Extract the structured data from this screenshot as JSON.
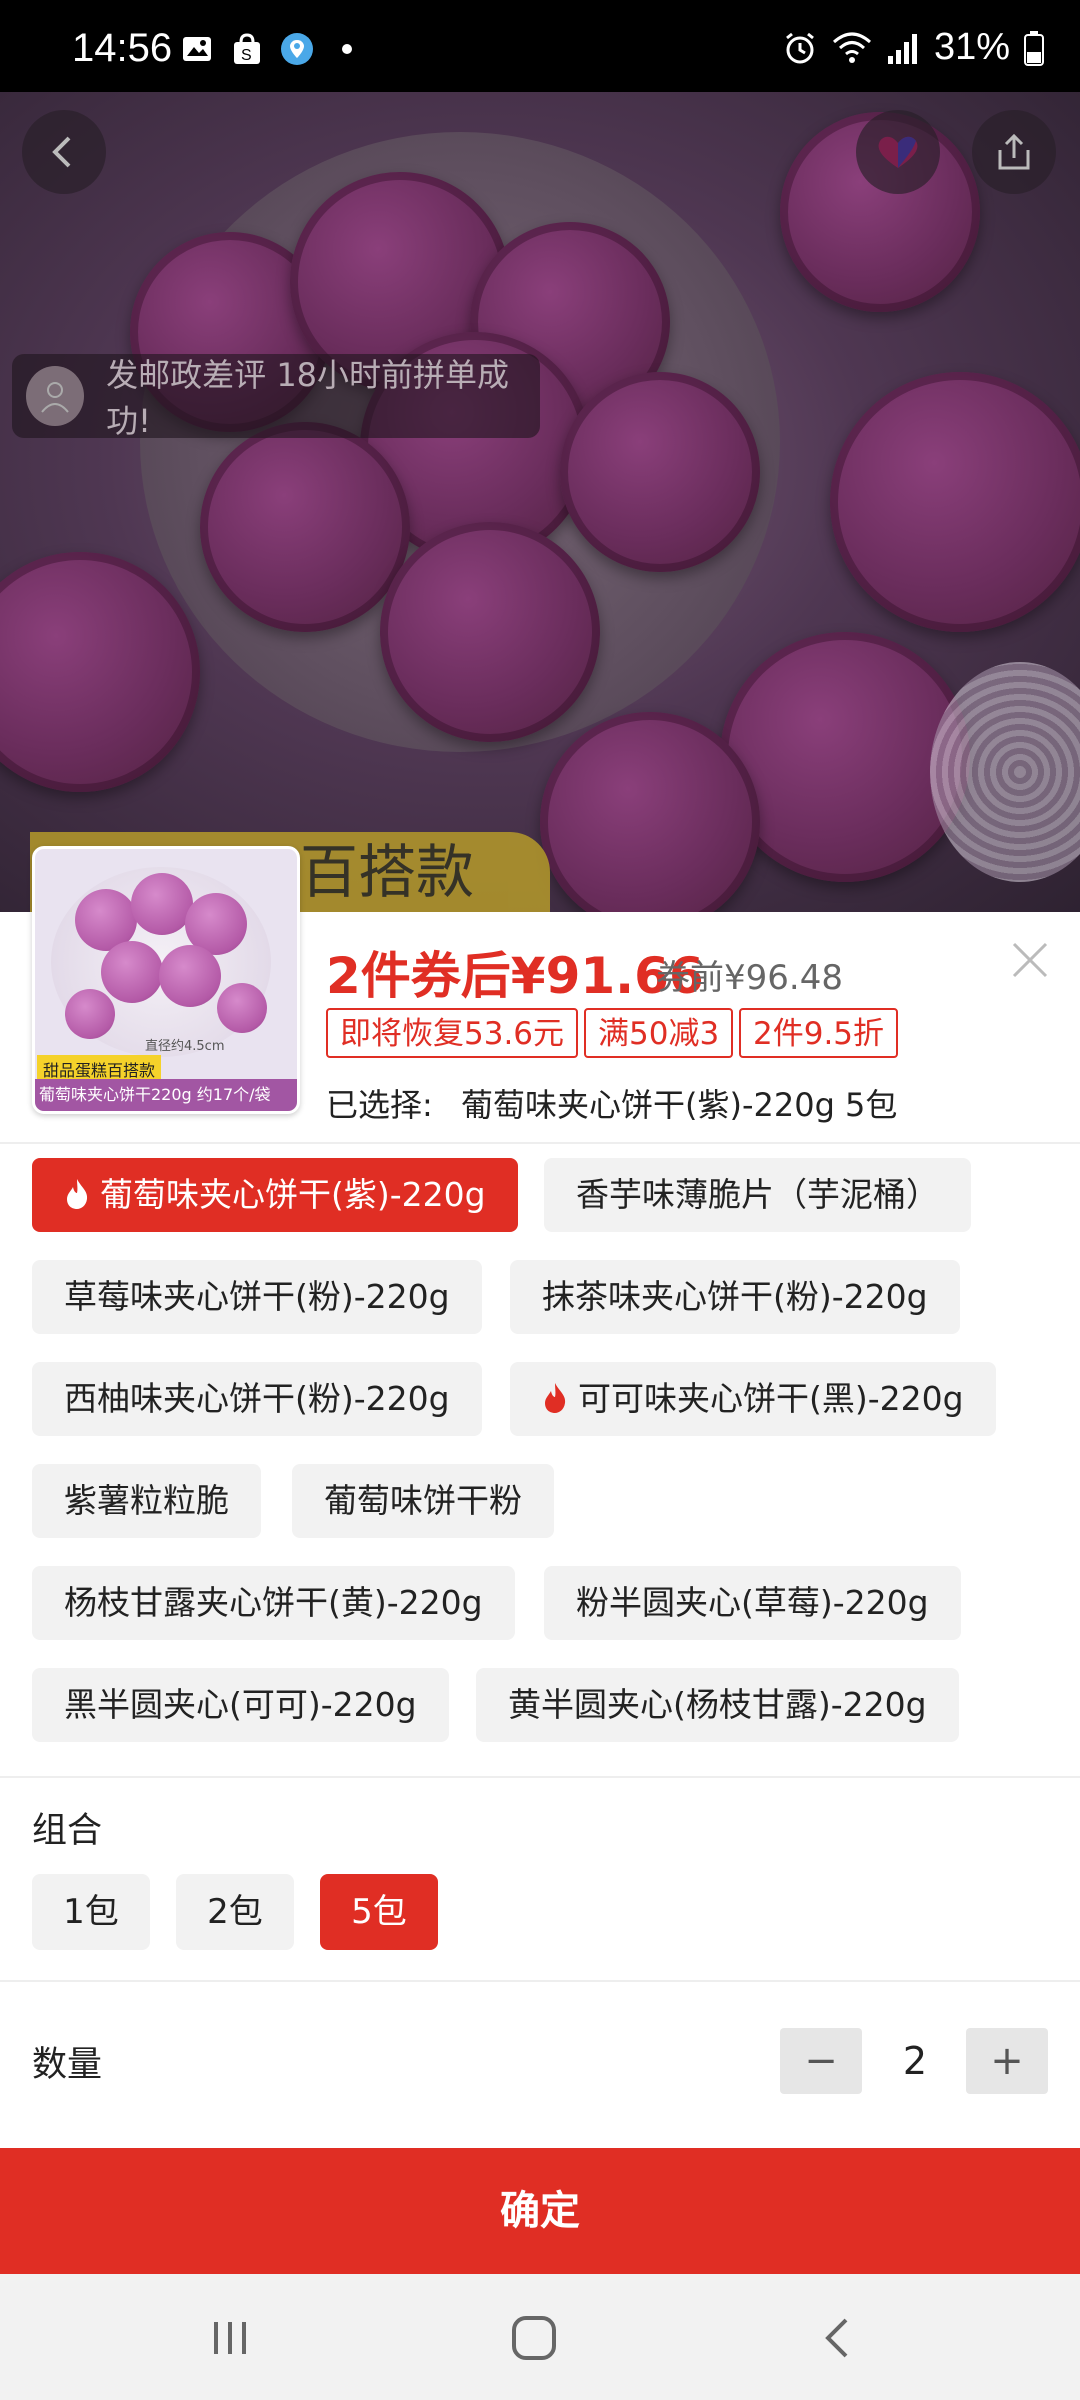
{
  "status_bar": {
    "time": "14:56",
    "battery": "31%",
    "icons": [
      "image-icon",
      "shopping-bag-icon",
      "location-icon",
      "dot-icon",
      "alarm-icon",
      "wifi-icon",
      "signal-icon",
      "battery-icon"
    ]
  },
  "hero": {
    "notice_text": "发邮政差评 18小时前拼单成功!",
    "tag_text": "百搭款"
  },
  "product": {
    "thumb_label_top": "甜品蛋糕百搭款",
    "thumb_label_bottom": "葡萄味夹心饼干220g  约17个/袋",
    "thumb_size_note": "直径约4.5cm",
    "price_main": "2件券后¥91.66",
    "price_old": "券前¥96.48",
    "promos": [
      "即将恢复53.6元",
      "满50减3",
      "2件9.5折"
    ],
    "selected_label": "已选择:",
    "selected_value": "葡萄味夹心饼干(紫)-220g 5包"
  },
  "options": [
    {
      "label": "葡萄味夹心饼干(紫)-220g",
      "hot": true,
      "active": true
    },
    {
      "label": "香芋味薄脆片（芋泥桶）",
      "hot": false,
      "active": false
    },
    {
      "label": "草莓味夹心饼干(粉)-220g",
      "hot": false,
      "active": false
    },
    {
      "label": "抹茶味夹心饼干(粉)-220g",
      "hot": false,
      "active": false
    },
    {
      "label": "西柚味夹心饼干(粉)-220g",
      "hot": false,
      "active": false
    },
    {
      "label": "可可味夹心饼干(黑)-220g",
      "hot": true,
      "active": false
    },
    {
      "label": "紫薯粒粒脆",
      "hot": false,
      "active": false
    },
    {
      "label": "葡萄味饼干粉",
      "hot": false,
      "active": false
    },
    {
      "label": "杨枝甘露夹心饼干(黄)-220g",
      "hot": false,
      "active": false
    },
    {
      "label": "粉半圆夹心(草莓)-220g",
      "hot": false,
      "active": false
    },
    {
      "label": "黑半圆夹心(可可)-220g",
      "hot": false,
      "active": false
    },
    {
      "label": "黄半圆夹心(杨枝甘露)-220g",
      "hot": false,
      "active": false
    }
  ],
  "combo": {
    "title": "组合",
    "items": [
      {
        "label": "1包",
        "active": false
      },
      {
        "label": "2包",
        "active": false
      },
      {
        "label": "5包",
        "active": true
      }
    ]
  },
  "quantity": {
    "title": "数量",
    "value": "2",
    "minus": "−",
    "plus": "+"
  },
  "confirm_label": "确定",
  "colors": {
    "accent": "#e02e24",
    "chip_bg": "#f2f2f2"
  }
}
